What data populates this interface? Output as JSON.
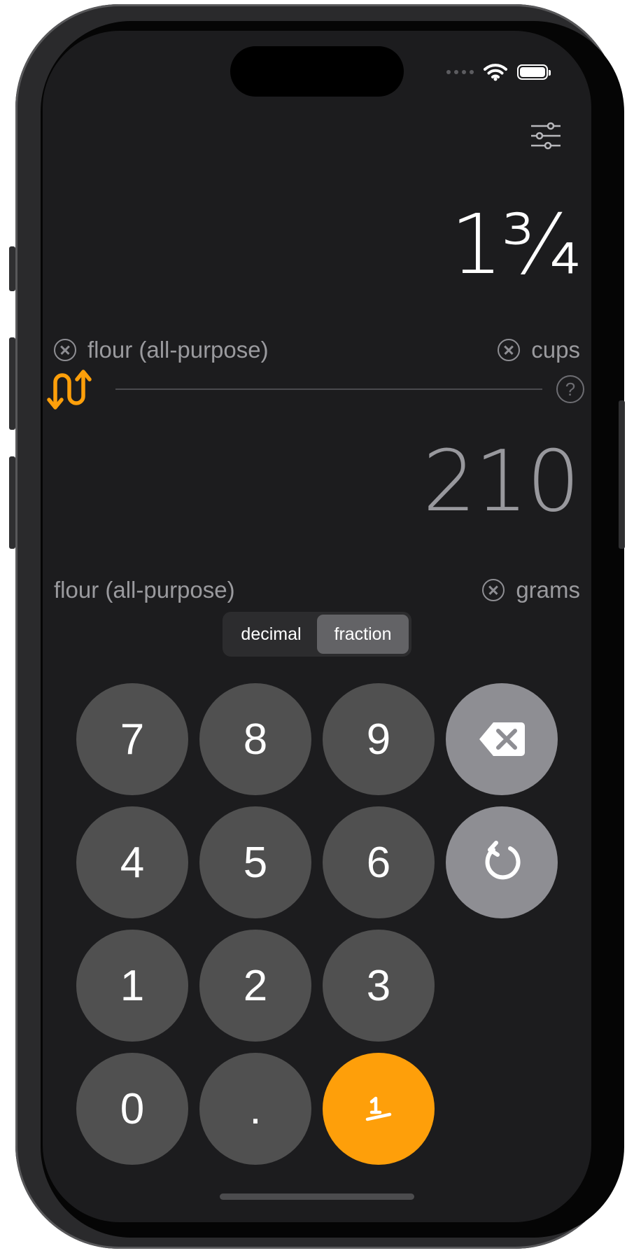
{
  "input": {
    "value": "1¾",
    "ingredient": "flour (all-purpose)",
    "unit": "cups"
  },
  "output": {
    "value": "210",
    "ingredient": "flour (all-purpose)",
    "unit": "grams"
  },
  "help": {
    "label": "?"
  },
  "format_toggle": {
    "options": [
      "decimal",
      "fraction"
    ],
    "selected": "fraction"
  },
  "keypad": {
    "k7": "7",
    "k8": "8",
    "k9": "9",
    "k4": "4",
    "k5": "5",
    "k6": "6",
    "k1": "1",
    "k2": "2",
    "k3": "3",
    "k0": "0",
    "dot": "."
  },
  "icons": {
    "settings": "sliders-icon",
    "swap": "swap-arrows-icon",
    "backspace": "backspace-icon",
    "reset": "reset-icon",
    "fraction": "fraction-icon",
    "clear": "clear-x-icon",
    "help": "question-icon"
  },
  "colors": {
    "accent": "#fe9f0a",
    "key": "#505050",
    "key_op": "#8e8e93",
    "background": "#1c1c1e"
  }
}
